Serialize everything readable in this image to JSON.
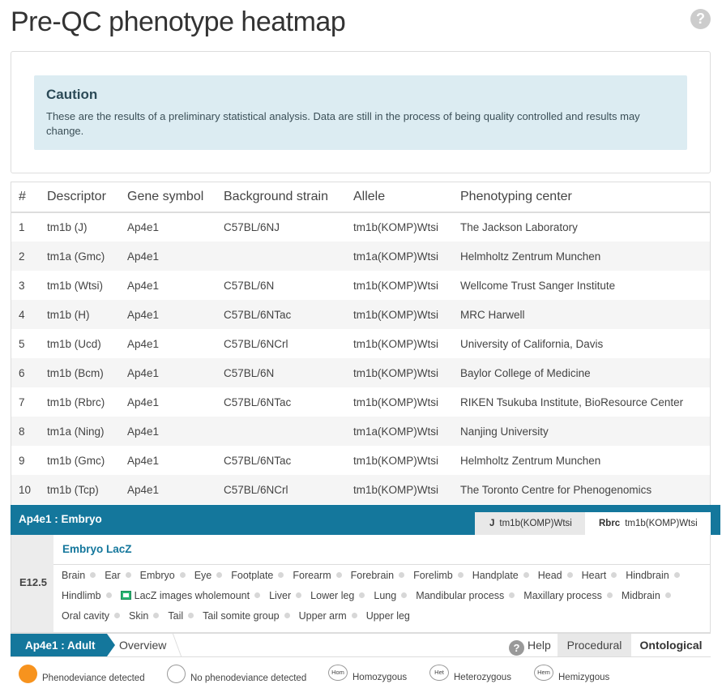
{
  "page": {
    "title": "Pre-QC phenotype heatmap",
    "help_icon": "?"
  },
  "caution": {
    "title": "Caution",
    "text": "These are the results of a preliminary statistical analysis. Data are still in the process of being quality controlled and results may change."
  },
  "table": {
    "headers": [
      "#",
      "Descriptor",
      "Gene symbol",
      "Background strain",
      "Allele",
      "Phenotyping center"
    ],
    "rows": [
      [
        "1",
        "tm1b (J)",
        "Ap4e1",
        "C57BL/6NJ",
        "tm1b(KOMP)Wtsi",
        "The Jackson Laboratory"
      ],
      [
        "2",
        "tm1a (Gmc)",
        "Ap4e1",
        "",
        "tm1a(KOMP)Wtsi",
        "Helmholtz Zentrum Munchen"
      ],
      [
        "3",
        "tm1b (Wtsi)",
        "Ap4e1",
        "C57BL/6N",
        "tm1b(KOMP)Wtsi",
        "Wellcome Trust Sanger Institute"
      ],
      [
        "4",
        "tm1b (H)",
        "Ap4e1",
        "C57BL/6NTac",
        "tm1b(KOMP)Wtsi",
        "MRC Harwell"
      ],
      [
        "5",
        "tm1b (Ucd)",
        "Ap4e1",
        "C57BL/6NCrl",
        "tm1b(KOMP)Wtsi",
        "University of California, Davis"
      ],
      [
        "6",
        "tm1b (Bcm)",
        "Ap4e1",
        "C57BL/6N",
        "tm1b(KOMP)Wtsi",
        "Baylor College of Medicine"
      ],
      [
        "7",
        "tm1b (Rbrc)",
        "Ap4e1",
        "C57BL/6NTac",
        "tm1b(KOMP)Wtsi",
        "RIKEN Tsukuba Institute, BioResource Center"
      ],
      [
        "8",
        "tm1a (Ning)",
        "Ap4e1",
        "",
        "tm1a(KOMP)Wtsi",
        "Nanjing University"
      ],
      [
        "9",
        "tm1b (Gmc)",
        "Ap4e1",
        "C57BL/6NTac",
        "tm1b(KOMP)Wtsi",
        "Helmholtz Zentrum Munchen"
      ],
      [
        "10",
        "tm1b (Tcp)",
        "Ap4e1",
        "C57BL/6NCrl",
        "tm1b(KOMP)Wtsi",
        "The Toronto Centre for Phenogenomics"
      ]
    ]
  },
  "embryo": {
    "title": "Ap4e1 : Embryo",
    "tabs": [
      {
        "key": "J",
        "label": "tm1b(KOMP)Wtsi"
      },
      {
        "key": "Rbrc",
        "label": "tm1b(KOMP)Wtsi"
      }
    ],
    "stage": "E12.5",
    "section_title": "Embryo LacZ",
    "terms": [
      "Brain",
      "Ear",
      "Embryo",
      "Eye",
      "Footplate",
      "Forearm",
      "Forebrain",
      "Forelimb",
      "Handplate",
      "Head",
      "Heart",
      "Hindbrain",
      "Hindlimb",
      "LacZ images wholemount",
      "Liver",
      "Lower leg",
      "Lung",
      "Mandibular process",
      "Maxillary process",
      "Midbrain",
      "Oral cavity",
      "Skin",
      "Tail",
      "Tail somite group",
      "Upper arm",
      "Upper leg"
    ]
  },
  "adult": {
    "title": "Ap4e1 : Adult",
    "overview": "Overview",
    "help": "Help",
    "procedural": "Procedural",
    "ontological": "Ontological"
  },
  "legend": {
    "pheno": "Phenodeviance detected",
    "no_pheno": "No phenodeviance detected",
    "hom_badge": "Hom",
    "hom": "Homozygous",
    "het_badge": "Het",
    "het": "Heterozygous",
    "hem_badge": "Hem",
    "hem": "Hemizygous"
  },
  "colors": {
    "accent": "#14779c",
    "pheno": "#f7931e",
    "caution_bg": "#dcecf2"
  }
}
